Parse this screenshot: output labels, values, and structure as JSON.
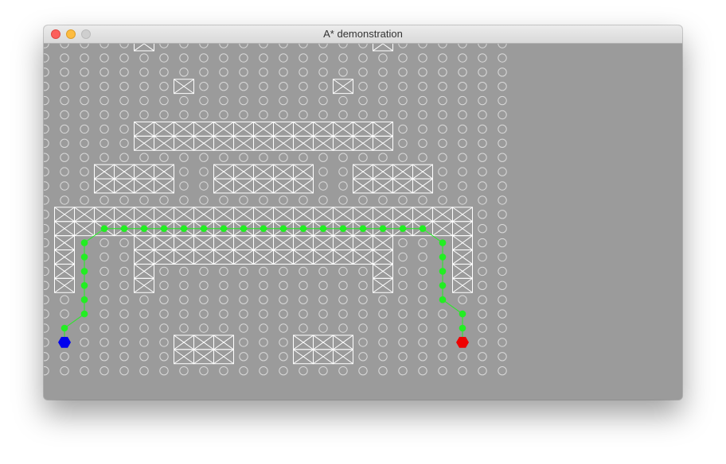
{
  "window": {
    "title": "A* demonstration",
    "buttons": [
      "close",
      "minimize",
      "zoom"
    ]
  },
  "grid": {
    "columns": 24,
    "rows": 24,
    "walkable_cell_marker": "circle",
    "obstacle_cell_marker": "crossed-box",
    "obstacle_cells": [
      [
        5,
        0
      ],
      [
        17,
        0
      ],
      [
        7,
        3
      ],
      [
        15,
        3
      ],
      [
        5,
        6
      ],
      [
        6,
        6
      ],
      [
        7,
        6
      ],
      [
        8,
        6
      ],
      [
        9,
        6
      ],
      [
        10,
        6
      ],
      [
        11,
        6
      ],
      [
        12,
        6
      ],
      [
        13,
        6
      ],
      [
        14,
        6
      ],
      [
        15,
        6
      ],
      [
        16,
        6
      ],
      [
        17,
        6
      ],
      [
        5,
        7
      ],
      [
        6,
        7
      ],
      [
        7,
        7
      ],
      [
        8,
        7
      ],
      [
        9,
        7
      ],
      [
        10,
        7
      ],
      [
        11,
        7
      ],
      [
        12,
        7
      ],
      [
        13,
        7
      ],
      [
        14,
        7
      ],
      [
        15,
        7
      ],
      [
        16,
        7
      ],
      [
        17,
        7
      ],
      [
        3,
        9
      ],
      [
        4,
        9
      ],
      [
        5,
        9
      ],
      [
        6,
        9
      ],
      [
        9,
        9
      ],
      [
        10,
        9
      ],
      [
        11,
        9
      ],
      [
        12,
        9
      ],
      [
        13,
        9
      ],
      [
        16,
        9
      ],
      [
        17,
        9
      ],
      [
        18,
        9
      ],
      [
        19,
        9
      ],
      [
        3,
        10
      ],
      [
        4,
        10
      ],
      [
        5,
        10
      ],
      [
        6,
        10
      ],
      [
        9,
        10
      ],
      [
        10,
        10
      ],
      [
        11,
        10
      ],
      [
        12,
        10
      ],
      [
        13,
        10
      ],
      [
        16,
        10
      ],
      [
        17,
        10
      ],
      [
        18,
        10
      ],
      [
        19,
        10
      ],
      [
        1,
        12
      ],
      [
        2,
        12
      ],
      [
        3,
        12
      ],
      [
        4,
        12
      ],
      [
        5,
        12
      ],
      [
        6,
        12
      ],
      [
        7,
        12
      ],
      [
        8,
        12
      ],
      [
        9,
        12
      ],
      [
        10,
        12
      ],
      [
        11,
        12
      ],
      [
        12,
        12
      ],
      [
        13,
        12
      ],
      [
        14,
        12
      ],
      [
        15,
        12
      ],
      [
        16,
        12
      ],
      [
        17,
        12
      ],
      [
        18,
        12
      ],
      [
        19,
        12
      ],
      [
        20,
        12
      ],
      [
        21,
        12
      ],
      [
        1,
        13
      ],
      [
        2,
        13
      ],
      [
        3,
        13
      ],
      [
        4,
        13
      ],
      [
        5,
        13
      ],
      [
        6,
        13
      ],
      [
        7,
        13
      ],
      [
        8,
        13
      ],
      [
        9,
        13
      ],
      [
        10,
        13
      ],
      [
        11,
        13
      ],
      [
        12,
        13
      ],
      [
        13,
        13
      ],
      [
        14,
        13
      ],
      [
        15,
        13
      ],
      [
        16,
        13
      ],
      [
        17,
        13
      ],
      [
        18,
        13
      ],
      [
        19,
        13
      ],
      [
        20,
        13
      ],
      [
        21,
        13
      ],
      [
        1,
        14
      ],
      [
        5,
        14
      ],
      [
        6,
        14
      ],
      [
        7,
        14
      ],
      [
        8,
        14
      ],
      [
        9,
        14
      ],
      [
        10,
        14
      ],
      [
        11,
        14
      ],
      [
        12,
        14
      ],
      [
        13,
        14
      ],
      [
        14,
        14
      ],
      [
        15,
        14
      ],
      [
        16,
        14
      ],
      [
        17,
        14
      ],
      [
        21,
        14
      ],
      [
        1,
        15
      ],
      [
        5,
        15
      ],
      [
        6,
        15
      ],
      [
        7,
        15
      ],
      [
        8,
        15
      ],
      [
        9,
        15
      ],
      [
        10,
        15
      ],
      [
        11,
        15
      ],
      [
        12,
        15
      ],
      [
        13,
        15
      ],
      [
        14,
        15
      ],
      [
        15,
        15
      ],
      [
        16,
        15
      ],
      [
        17,
        15
      ],
      [
        21,
        15
      ],
      [
        1,
        16
      ],
      [
        5,
        16
      ],
      [
        17,
        16
      ],
      [
        21,
        16
      ],
      [
        1,
        17
      ],
      [
        5,
        17
      ],
      [
        17,
        17
      ],
      [
        21,
        17
      ],
      [
        7,
        21
      ],
      [
        8,
        21
      ],
      [
        9,
        21
      ],
      [
        13,
        21
      ],
      [
        14,
        21
      ],
      [
        15,
        21
      ],
      [
        7,
        22
      ],
      [
        8,
        22
      ],
      [
        9,
        22
      ],
      [
        13,
        22
      ],
      [
        14,
        22
      ],
      [
        15,
        22
      ]
    ],
    "path_cells": [
      [
        1,
        20
      ],
      [
        2,
        19
      ],
      [
        2,
        18
      ],
      [
        2,
        17
      ],
      [
        2,
        16
      ],
      [
        2,
        15
      ],
      [
        2,
        14
      ],
      [
        3,
        13
      ],
      [
        4,
        13
      ],
      [
        5,
        13
      ],
      [
        6,
        13
      ],
      [
        7,
        13
      ],
      [
        8,
        13
      ],
      [
        9,
        13
      ],
      [
        10,
        13
      ],
      [
        11,
        13
      ],
      [
        12,
        13
      ],
      [
        13,
        13
      ],
      [
        14,
        13
      ],
      [
        15,
        13
      ],
      [
        16,
        13
      ],
      [
        17,
        13
      ],
      [
        18,
        13
      ],
      [
        19,
        13
      ],
      [
        20,
        14
      ],
      [
        20,
        15
      ],
      [
        20,
        16
      ],
      [
        20,
        17
      ],
      [
        20,
        18
      ],
      [
        21,
        19
      ],
      [
        21,
        20
      ]
    ],
    "start_cell": [
      1,
      21
    ],
    "goal_cell": [
      21,
      21
    ]
  },
  "colors": {
    "background": "#9b9b9b",
    "grid_lines": "#ffffff",
    "path": "#22ee22",
    "start": "#0000ee",
    "goal": "#ee0000"
  }
}
